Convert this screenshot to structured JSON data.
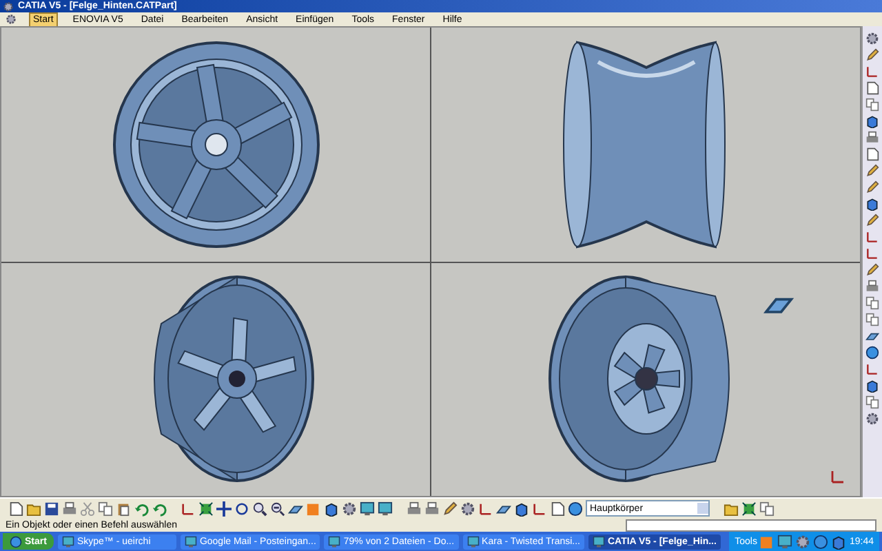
{
  "window": {
    "title": "CATIA V5 - [Felge_Hinten.CATPart]"
  },
  "menu": [
    {
      "label": "Start",
      "selected": true
    },
    {
      "label": "ENOVIA V5",
      "selected": false
    },
    {
      "label": "Datei",
      "selected": false
    },
    {
      "label": "Bearbeiten",
      "selected": false
    },
    {
      "label": "Ansicht",
      "selected": false
    },
    {
      "label": "Einfügen",
      "selected": false
    },
    {
      "label": "Tools",
      "selected": false
    },
    {
      "label": "Fenster",
      "selected": false
    },
    {
      "label": "Hilfe",
      "selected": false
    }
  ],
  "viewports": [
    {
      "kind": "front"
    },
    {
      "kind": "side"
    },
    {
      "kind": "back"
    },
    {
      "kind": "rear"
    }
  ],
  "toolbar": {
    "body_select": "Hauptkörper"
  },
  "status_bar": {
    "message": "Ein Objekt oder einen Befehl auswählen"
  },
  "taskbar": {
    "start": "Start",
    "items": [
      {
        "label": "Skype™ - ueirchi",
        "selected": false
      },
      {
        "label": "Google Mail - Posteingan...",
        "selected": false
      },
      {
        "label": "79% von 2 Dateien - Do...",
        "selected": false
      },
      {
        "label": "Kara - Twisted Transi...",
        "selected": false
      },
      {
        "label": "CATIA V5 - [Felge_Hin...",
        "selected": true
      }
    ],
    "tray_label": "Tools",
    "clock": "19:44"
  }
}
